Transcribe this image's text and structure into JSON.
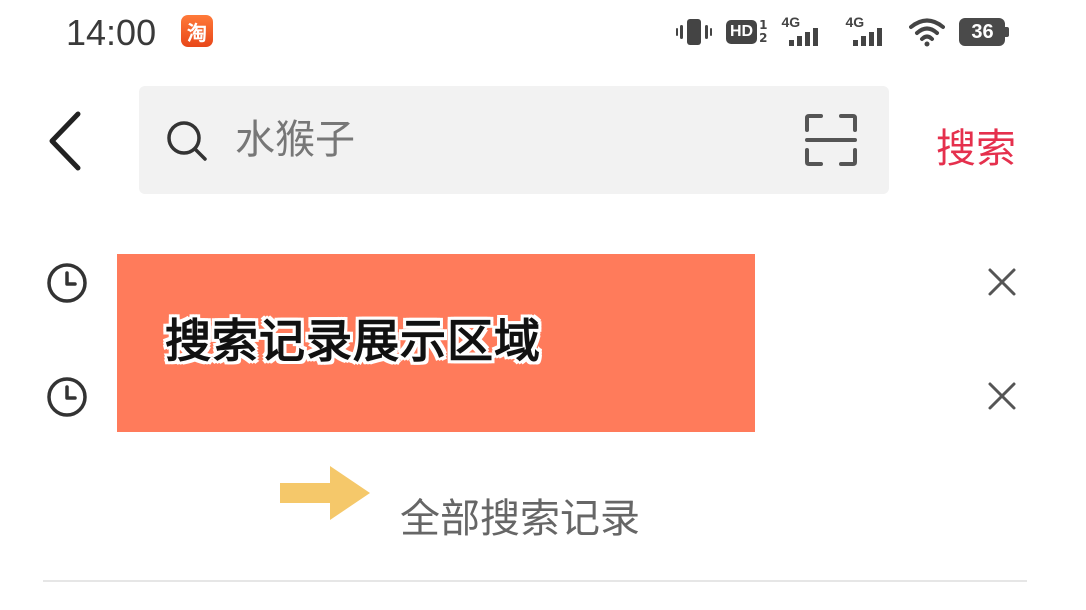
{
  "status_bar": {
    "time": "14:00",
    "app_badge": "淘",
    "hd_label": "HD",
    "sim1": "1",
    "sim2": "2",
    "net1": "4G",
    "net2": "4G",
    "battery": "36"
  },
  "search": {
    "placeholder": "水猴子",
    "button_label": "搜索"
  },
  "history": {
    "overlay_text": "搜索记录展示区域",
    "all_history_label": "全部搜索记录"
  },
  "colors": {
    "accent": "#e5304d",
    "overlay": "#ff7b5b",
    "arrow": "#f5c86a"
  },
  "icons": [
    "back-icon",
    "search-icon",
    "scan-icon",
    "clock-icon",
    "close-icon",
    "arrow-right-icon",
    "vibrate-icon",
    "wifi-icon",
    "battery-icon"
  ]
}
